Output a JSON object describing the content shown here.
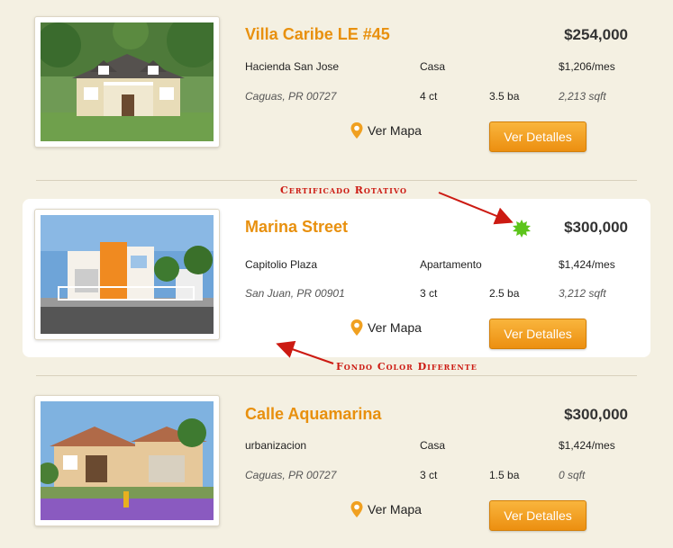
{
  "listings": [
    {
      "title": "Villa Caribe LE #45",
      "price": "$254,000",
      "community": "Hacienda San Jose",
      "type": "Casa",
      "monthly": "$1,206/mes",
      "location": "Caguas, PR 00727",
      "beds": "4 ct",
      "baths": "3.5 ba",
      "sqft": "2,213 sqft",
      "map_label": "Ver Mapa",
      "details_label": "Ver Detalles"
    },
    {
      "title": "Marina Street",
      "price": "$300,000",
      "community": "Capitolio Plaza",
      "type": "Apartamento",
      "monthly": "$1,424/mes",
      "location": "San Juan, PR 00901",
      "beds": "3 ct",
      "baths": "2.5 ba",
      "sqft": "3,212 sqft",
      "map_label": "Ver Mapa",
      "details_label": "Ver Detalles"
    },
    {
      "title": "Calle Aquamarina",
      "price": "$300,000",
      "community": "urbanizacion",
      "type": "Casa",
      "monthly": "$1,424/mes",
      "location": "Caguas, PR 00727",
      "beds": "3 ct",
      "baths": "1.5 ba",
      "sqft": "0 sqft",
      "map_label": "Ver Mapa",
      "details_label": "Ver Detalles"
    }
  ],
  "annotations": {
    "certificate": "Certificado  Rotativo",
    "background": "Fondo Color Diferente"
  },
  "colors": {
    "accent": "#e8900e",
    "button": "#f0a020",
    "annotation": "#cc1a12",
    "badge": "#5cc41a",
    "page_bg": "#f4f0e2"
  },
  "icons": {
    "map_pin": "map-pin-icon",
    "certified_badge": "certified-badge-icon"
  }
}
